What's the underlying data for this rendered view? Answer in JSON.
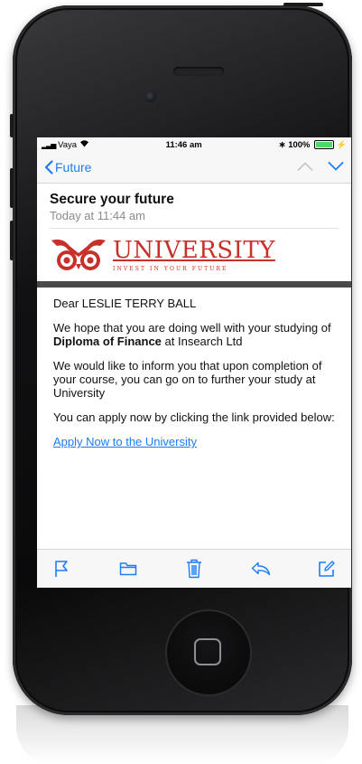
{
  "status_bar": {
    "carrier": "Vaya",
    "time": "11:46 am",
    "battery": "100%"
  },
  "nav": {
    "back_label": "Future"
  },
  "email": {
    "subject": "Secure your future",
    "date": "Today at 11:44 am",
    "logo": {
      "name": "UNIVERSITY",
      "tagline": "INVEST IN YOUR FUTURE"
    },
    "greeting": "Dear LESLIE TERRY BALL",
    "paragraph1_before": "We hope that you are doing well with your studying of ",
    "paragraph1_bold": "Diploma of Finance",
    "paragraph1_after": " at Insearch Ltd",
    "paragraph2": "We would like to inform you that upon completion of your course, you can go on to further your study at  University",
    "paragraph3": "You can apply now by clicking the link provided below:",
    "link_text": "Apply Now to the University"
  },
  "colors": {
    "ios_blue": "#1e7cf5",
    "brand_red": "#c8302a"
  },
  "toolbar_icons": [
    "flag-icon",
    "folder-icon",
    "trash-icon",
    "reply-icon",
    "compose-icon"
  ]
}
